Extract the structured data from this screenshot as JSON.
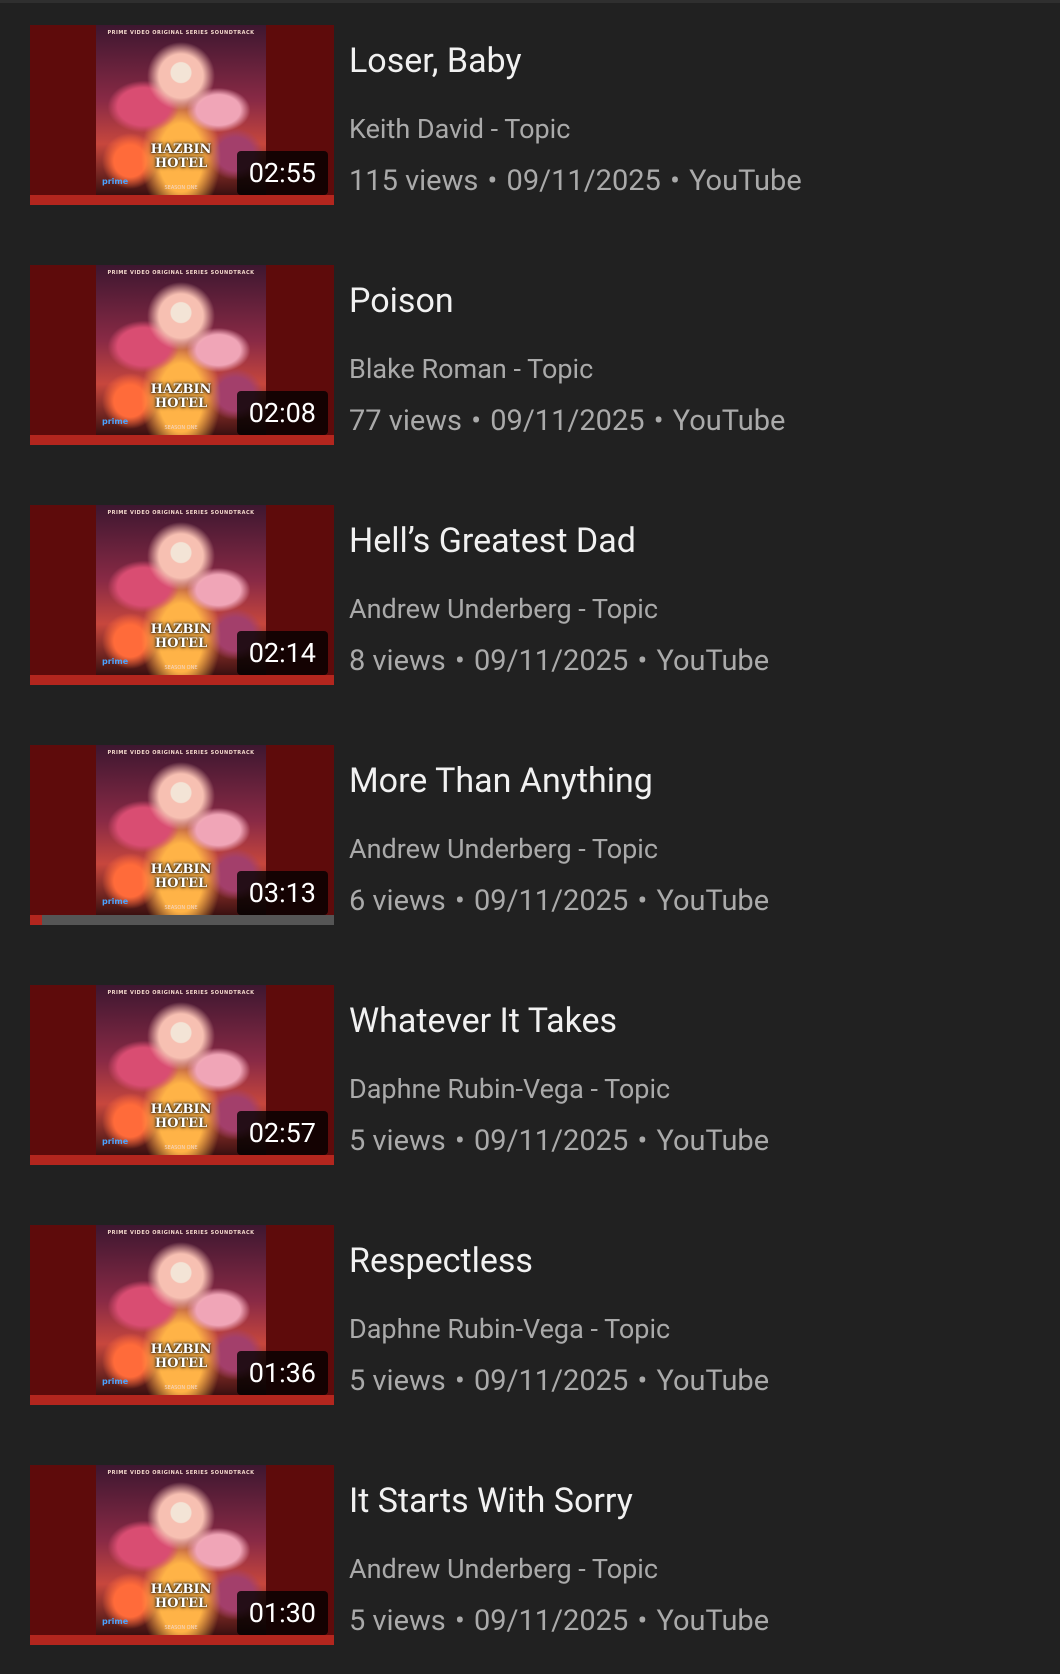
{
  "videos": [
    {
      "title": "Loser, Baby",
      "channel": "Keith David - Topic",
      "views": "115 views",
      "date": "09/11/2025",
      "source": "YouTube",
      "duration": "02:55",
      "watched_fraction": 1.0
    },
    {
      "title": "Poison",
      "channel": "Blake Roman - Topic",
      "views": "77 views",
      "date": "09/11/2025",
      "source": "YouTube",
      "duration": "02:08",
      "watched_fraction": 1.0
    },
    {
      "title": "Hell’s Greatest Dad",
      "channel": "Andrew Underberg - Topic",
      "views": "8 views",
      "date": "09/11/2025",
      "source": "YouTube",
      "duration": "02:14",
      "watched_fraction": 1.0
    },
    {
      "title": "More Than Anything",
      "channel": "Andrew Underberg - Topic",
      "views": "6 views",
      "date": "09/11/2025",
      "source": "YouTube",
      "duration": "03:13",
      "watched_fraction": 0.04
    },
    {
      "title": "Whatever It Takes",
      "channel": "Daphne Rubin-Vega - Topic",
      "views": "5 views",
      "date": "09/11/2025",
      "source": "YouTube",
      "duration": "02:57",
      "watched_fraction": 1.0
    },
    {
      "title": "Respectless",
      "channel": "Daphne Rubin-Vega - Topic",
      "views": "5 views",
      "date": "09/11/2025",
      "source": "YouTube",
      "duration": "01:36",
      "watched_fraction": 1.0
    },
    {
      "title": "It Starts With Sorry",
      "channel": "Andrew Underberg - Topic",
      "views": "5 views",
      "date": "09/11/2025",
      "source": "YouTube",
      "duration": "01:30",
      "watched_fraction": 1.0
    }
  ],
  "thumbnail": {
    "top_text": "PRIME VIDEO ORIGINAL SERIES SOUNDTRACK",
    "logo_line1": "HAZBIN",
    "logo_line2": "HOTEL",
    "bottom_text": "SEASON ONE",
    "badge": "prime"
  },
  "separator": "•",
  "colors": {
    "background": "#212121",
    "thumb_bg": "#5e0b0b",
    "progress_watched": "#b3261e",
    "progress_track": "#555555",
    "title_text": "#f1f1f1",
    "meta_text": "#aaaaaa"
  }
}
